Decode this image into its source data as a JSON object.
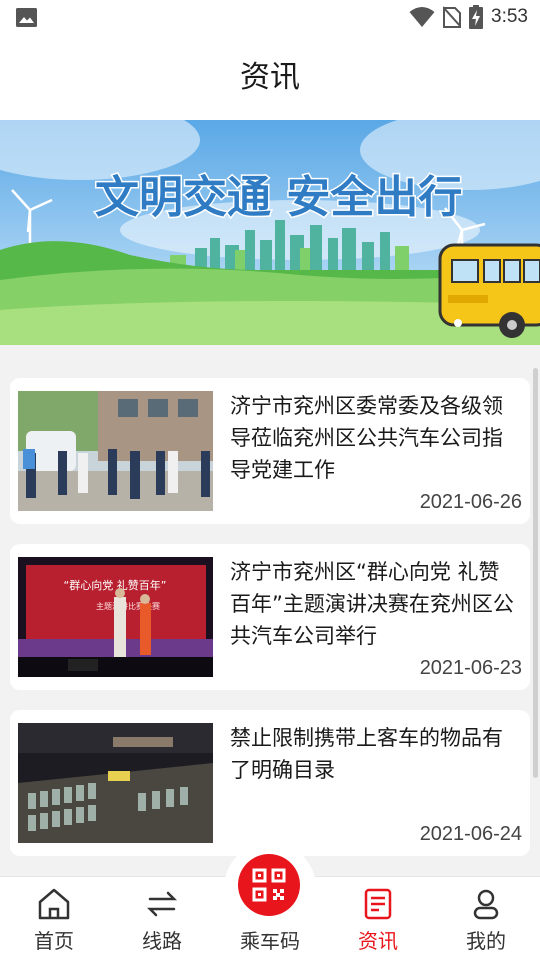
{
  "status": {
    "time": "3:53"
  },
  "header": {
    "title": "资讯"
  },
  "banner": {
    "slogan": "文明交通 安全出行"
  },
  "news": [
    {
      "title": "济宁市兖州区委常委及各级领导莅临兖州区公共汽车公司指导党建工作",
      "date": "2021-06-26"
    },
    {
      "title": "济宁市兖州区“群心向党 礼赞百年”主题演讲决赛在兖州区公共汽车公司举行",
      "date": "2021-06-23",
      "stage_text": "“群心向党 礼赞百年”",
      "stage_subtext": "主题演讲比赛决赛"
    },
    {
      "title": "禁止限制携带上客车的物品有了明确目录",
      "date": "2021-06-24"
    }
  ],
  "tabs": [
    {
      "label": "首页",
      "icon": "home-icon"
    },
    {
      "label": "线路",
      "icon": "route-icon"
    },
    {
      "label": "乘车码",
      "icon": "qr-code-icon"
    },
    {
      "label": "资讯",
      "icon": "news-icon",
      "active": true
    },
    {
      "label": "我的",
      "icon": "profile-icon"
    }
  ],
  "colors": {
    "accent": "#e8161c",
    "banner_sky": "#6fb5e8",
    "banner_grass": "#6cc24a",
    "bus_yellow": "#f5c518"
  }
}
